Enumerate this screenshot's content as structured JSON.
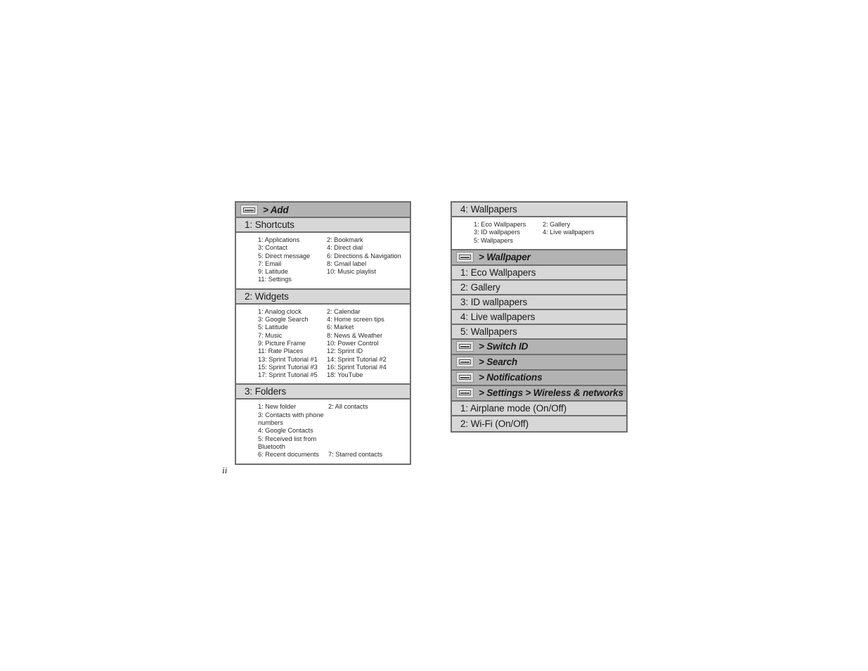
{
  "page": {
    "folio": "ii"
  },
  "icons": {
    "menu_key": "menu-key-icon"
  },
  "left_table": {
    "name": "add-menu-map",
    "rows": [
      {
        "type": "key",
        "label": "> Add"
      },
      {
        "type": "section",
        "label": "1: Shortcuts"
      },
      {
        "type": "body",
        "items": [
          [
            "1: Applications",
            "2: Bookmark"
          ],
          [
            "3: Contact",
            "4: Direct dial"
          ],
          [
            "5: Direct message",
            "6: Directions & Navigation"
          ],
          [
            "7: Email",
            "8: Gmail label"
          ],
          [
            "9: Latitude",
            "10: Music playlist"
          ],
          [
            "11: Settings",
            ""
          ]
        ]
      },
      {
        "type": "section",
        "label": "2: Widgets"
      },
      {
        "type": "body",
        "items": [
          [
            "1: Analog clock",
            "2: Calendar"
          ],
          [
            "3: Google Search",
            "4: Home screen tips"
          ],
          [
            "5: Latitude",
            "6: Market"
          ],
          [
            "7: Music",
            "8: News & Weather"
          ],
          [
            "9: Picture Frame",
            "10: Power Control"
          ],
          [
            "11: Rate Places",
            "12: Sprint ID"
          ],
          [
            "13: Sprint Tutorial #1",
            "14: Sprint Tutorial #2"
          ],
          [
            "15: Sprint Tutorial #3",
            "16: Sprint Tutorial #4"
          ],
          [
            "17: Sprint Tutorial #5",
            "18: YouTube"
          ]
        ]
      },
      {
        "type": "section",
        "label": "3: Folders"
      },
      {
        "type": "body",
        "variant": "folders",
        "items": [
          [
            "1: New folder",
            "2: All contacts"
          ],
          [
            "3: Contacts with phone numbers",
            ""
          ],
          [
            "4: Google Contacts",
            ""
          ],
          [
            "5: Received list from Bluetooth",
            ""
          ],
          [
            "6: Recent documents",
            "7: Starred contacts"
          ]
        ]
      }
    ]
  },
  "right_table": {
    "name": "wallpaper-menu-map",
    "rows": [
      {
        "type": "section",
        "label": "4: Wallpapers"
      },
      {
        "type": "body",
        "items": [
          [
            "1: Eco Wallpapers",
            "2: Gallery"
          ],
          [
            "3: ID wallpapers",
            "4: Live wallpapers"
          ],
          [
            "5: Wallpapers",
            ""
          ]
        ]
      },
      {
        "type": "key",
        "label": "> Wallpaper"
      },
      {
        "type": "section",
        "label": "1: Eco Wallpapers"
      },
      {
        "type": "section",
        "label": "2: Gallery"
      },
      {
        "type": "section",
        "label": "3: ID wallpapers"
      },
      {
        "type": "section",
        "label": "4: Live wallpapers"
      },
      {
        "type": "section",
        "label": "5: Wallpapers"
      },
      {
        "type": "key",
        "label": "> Switch ID"
      },
      {
        "type": "key",
        "label": "> Search"
      },
      {
        "type": "key",
        "label": "> Notifications"
      },
      {
        "type": "key",
        "label": "> Settings > Wireless & networks"
      },
      {
        "type": "section",
        "label": "1: Airplane mode (On/Off)"
      },
      {
        "type": "section",
        "label": "2: Wi-Fi (On/Off)"
      }
    ]
  },
  "colors": {
    "key_row_bg": "#b3b3b3",
    "section_row_bg": "#d7d7d7",
    "body_bg": "#ffffff",
    "border": "#6e6e6e",
    "text": "#1a1a1a",
    "sub_text": "#2b2b2b"
  }
}
